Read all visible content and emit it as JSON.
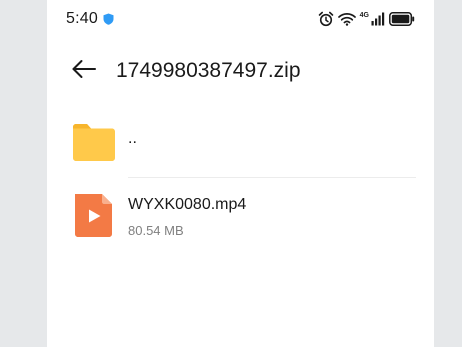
{
  "status_bar": {
    "time": "5:40",
    "network_label": "4G",
    "icons": [
      "shield-icon",
      "alarm-icon",
      "wifi-icon",
      "cellular-signal-icon",
      "battery-icon"
    ]
  },
  "header": {
    "title": "1749980387497.zip",
    "back_icon": "arrow-left-icon"
  },
  "list": {
    "items": [
      {
        "type": "parent-folder",
        "label": "..",
        "icon": "folder-icon",
        "icon_color": "#ffc94a"
      },
      {
        "type": "file",
        "name": "WYXK0080.mp4",
        "size": "80.54 MB",
        "icon": "video-file-icon",
        "icon_color": "#f37a45"
      }
    ]
  },
  "colors": {
    "background": "#ffffff",
    "outer_background": "#e6e8ea",
    "shield_accent": "#2f9bf5",
    "secondary_text": "#808080"
  }
}
